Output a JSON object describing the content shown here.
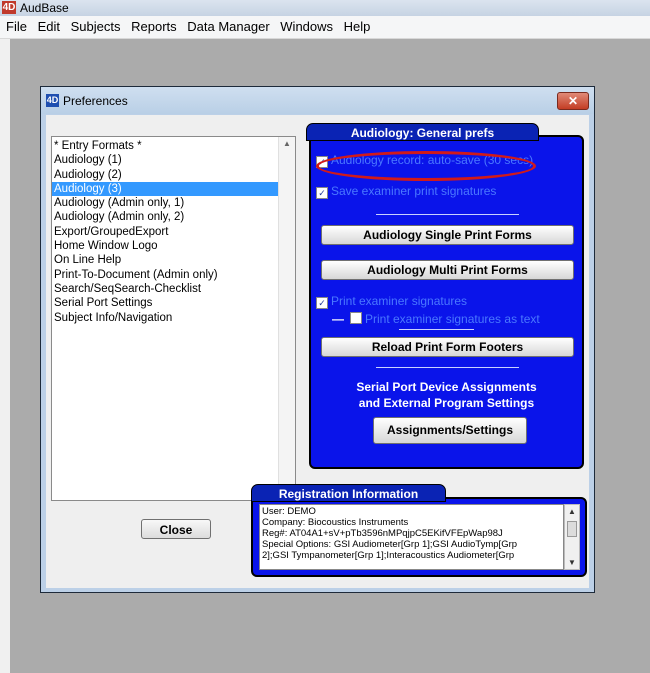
{
  "app": {
    "title": "AudBase",
    "icon": "4D"
  },
  "menu": [
    "File",
    "Edit",
    "Subjects",
    "Reports",
    "Data Manager",
    "Windows",
    "Help"
  ],
  "dialog": {
    "title": "Preferences",
    "close_glyph": "✕",
    "list_items": [
      "* Entry Formats *",
      "Audiology (1)",
      "Audiology (2)",
      "Audiology (3)",
      "Audiology (Admin only, 1)",
      "Audiology (Admin only, 2)",
      "Export/GroupedExport",
      "Home Window Logo",
      "On Line Help",
      "Print-To-Document (Admin only)",
      "Search/SeqSearch-Checklist",
      "Serial Port Settings",
      "Subject Info/Navigation"
    ],
    "selected_item": "Audiology (3)",
    "close_button": "Close"
  },
  "panel": {
    "header": "Audiology: General prefs",
    "autosave_label": "Audiology record: auto-save (30 secs)",
    "autosave_checked": true,
    "save_sig_label": "Save examiner print signatures",
    "save_sig_checked": true,
    "single_print_button": "Audiology Single Print Forms",
    "multi_print_button": "Audiology Multi Print Forms",
    "print_sig_label": "Print examiner signatures",
    "print_sig_checked": true,
    "print_sig_text_label": "Print examiner signatures as text",
    "print_sig_text_checked": false,
    "reload_button": "Reload Print Form Footers",
    "serial_text_1": "Serial Port Device Assignments",
    "serial_text_2": "and External Program Settings",
    "assignments_button": "Assignments/Settings"
  },
  "registration": {
    "header": "Registration Information",
    "lines": [
      "User: DEMO",
      "Company: Biocoustics Instruments",
      "Reg#:  AT04A1+sV+pTb3596nMPqjpC5EKifVFEpWap98J",
      "Special Options: GSI Audiometer[Grp 1];GSI AudioTymp[Grp",
      "2];GSI Tympanometer[Grp 1];Interacoustics Audiometer[Grp"
    ]
  },
  "colors": {
    "panel_blue": "#0a14ea",
    "highlight_ring": "#d11a1a",
    "selection": "#3399ff"
  }
}
